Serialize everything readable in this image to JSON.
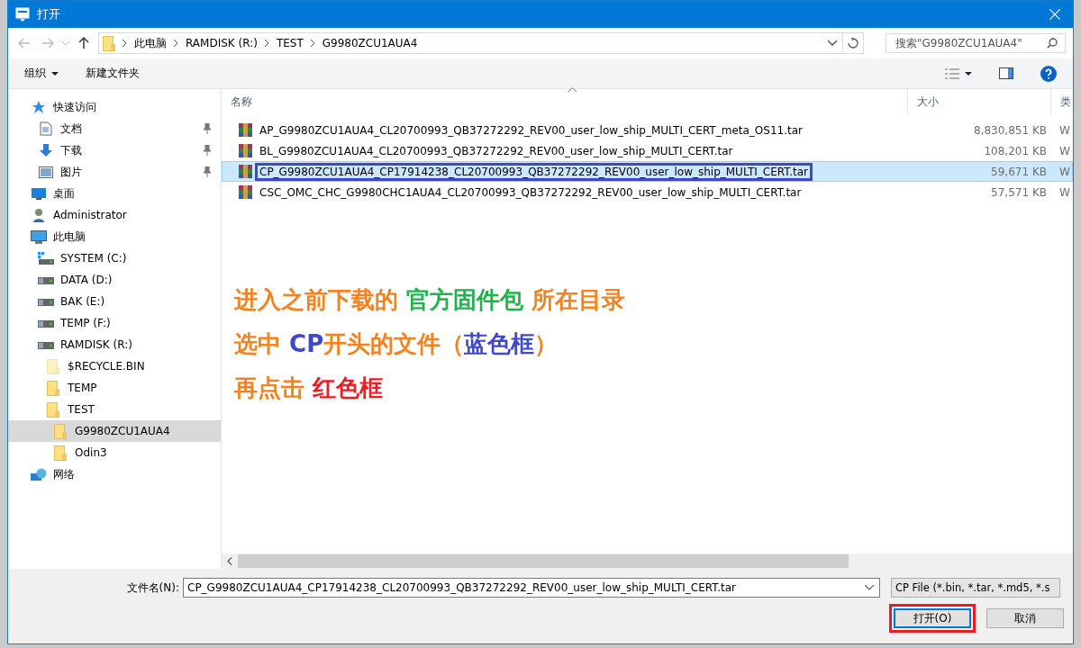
{
  "window": {
    "title": "打开"
  },
  "address": {
    "path": [
      "此电脑",
      "RAMDISK (R:)",
      "TEST",
      "G9980ZCU1AUA4"
    ]
  },
  "search": {
    "placeholder": "搜索\"G9980ZCU1AUA4\""
  },
  "toolbar": {
    "organize": "组织",
    "new_folder": "新建文件夹"
  },
  "sidebar": {
    "items": [
      {
        "label": "快速访问",
        "kind": "star",
        "selected": false,
        "children": [
          {
            "label": "文档",
            "kind": "document",
            "pinned": true,
            "selected": false
          },
          {
            "label": "下载",
            "kind": "download",
            "pinned": true,
            "selected": false
          },
          {
            "label": "图片",
            "kind": "picture",
            "pinned": true,
            "selected": false
          }
        ]
      },
      {
        "label": "桌面",
        "kind": "desktop",
        "selected": false
      },
      {
        "label": "Administrator",
        "kind": "user",
        "selected": false
      },
      {
        "label": "此电脑",
        "kind": "pc",
        "selected": false,
        "children": [
          {
            "label": "SYSTEM (C:)",
            "kind": "system-drive",
            "selected": false
          },
          {
            "label": "DATA (D:)",
            "kind": "drive",
            "selected": false
          },
          {
            "label": "BAK (E:)",
            "kind": "drive",
            "selected": false
          },
          {
            "label": "TEMP (F:)",
            "kind": "drive",
            "selected": false
          },
          {
            "label": "RAMDISK (R:)",
            "kind": "drive",
            "selected": false,
            "children": [
              {
                "label": "$RECYCLE.BIN",
                "kind": "hidden-folder",
                "selected": false
              },
              {
                "label": "TEMP",
                "kind": "folder",
                "selected": false
              },
              {
                "label": "TEST",
                "kind": "folder",
                "selected": false,
                "children": [
                  {
                    "label": "G9980ZCU1AUA4",
                    "kind": "folder",
                    "selected": true
                  },
                  {
                    "label": "Odin3",
                    "kind": "folder",
                    "selected": false
                  }
                ]
              }
            ]
          }
        ]
      },
      {
        "label": "网络",
        "kind": "network",
        "selected": false
      }
    ]
  },
  "table": {
    "columns": [
      "名称",
      "大小",
      "类"
    ],
    "rows": [
      {
        "name": "AP_G9980ZCU1AUA4_CL20700993_QB37272292_REV00_user_low_ship_MULTI_CERT_meta_OS11.tar",
        "size": "8,830,851 KB",
        "column_3": "W",
        "selected": false,
        "outlined": false
      },
      {
        "name": "BL_G9980ZCU1AUA4_CL20700993_QB37272292_REV00_user_low_ship_MULTI_CERT.tar",
        "size": "108,201 KB",
        "column_3": "W",
        "selected": false,
        "outlined": false
      },
      {
        "name": "CP_G9980ZCU1AUA4_CP17914238_CL20700993_QB37272292_REV00_user_low_ship_MULTI_CERT.tar",
        "size": "59,671 KB",
        "column_3": "W",
        "selected": true,
        "outlined": true
      },
      {
        "name": "CSC_OMC_CHC_G9980CHC1AUA4_CL20700993_QB37272292_REV00_user_low_ship_MULTI_CERT.tar",
        "size": "57,571 KB",
        "column_3": "W",
        "selected": false,
        "outlined": false
      }
    ]
  },
  "annotation": {
    "lines": [
      [
        {
          "text": "进入之前下载的 ",
          "color": "#f5821f"
        },
        {
          "text": "官方固件包",
          "color": "#22b24c"
        },
        {
          "text": " 所在目录",
          "color": "#f5821f"
        }
      ],
      [
        {
          "text": "选中 ",
          "color": "#f5821f"
        },
        {
          "text": "CP",
          "color": "#3f48cc"
        },
        {
          "text": "开头的文件（",
          "color": "#f5821f"
        },
        {
          "text": "蓝色框",
          "color": "#3f48cc"
        },
        {
          "text": "）",
          "color": "#f5821f"
        }
      ],
      [
        {
          "text": "再点击 ",
          "color": "#f5821f"
        },
        {
          "text": "红色框",
          "color": "#ed1c24"
        }
      ]
    ]
  },
  "footer": {
    "filename_label": "文件名(N):",
    "filename": "CP_G9980ZCU1AUA4_CP17914238_CL20700993_QB37272292_REV00_user_low_ship_MULTI_CERT.tar",
    "filter": "CP File (*.bin, *.tar, *.md5, *.s",
    "open": {
      "label": "打开(O)",
      "outlined": true
    },
    "cancel": "取消"
  }
}
